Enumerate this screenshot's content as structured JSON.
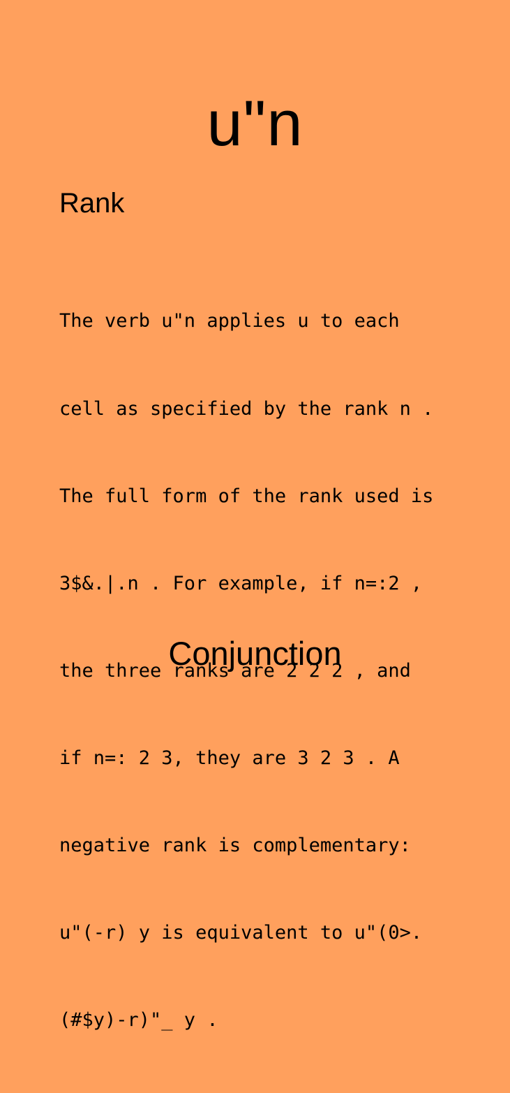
{
  "card": {
    "symbol": "u\"n",
    "name": "Rank",
    "description_lines": [
      "The verb u\"n applies u to each",
      "cell as specified by the rank n .",
      "The full form of the rank used is",
      "3$&.|.n . For example, if n=:2 ,",
      "the three ranks are 2 2 2 , and",
      "if n=: 2 3, they are 3 2 3 . A",
      "negative rank is complementary:",
      "u\"(-r) y is equivalent to u\"(0>.",
      "(#$y)-r)\"_ y ."
    ],
    "part_of_speech": "Conjunction"
  },
  "colors": {
    "background": "#ffa05d",
    "text": "#000000"
  }
}
